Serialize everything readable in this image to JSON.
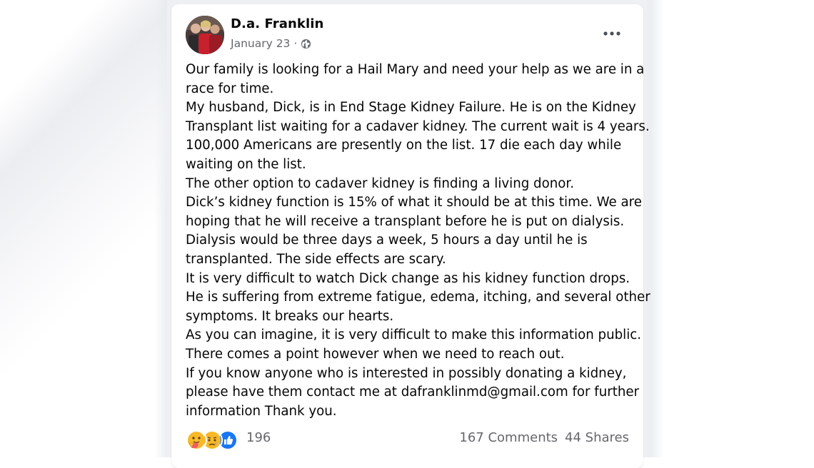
{
  "post": {
    "author": "D.a. Franklin",
    "date": "January 23",
    "separator": "·",
    "privacy_icon": "globe-icon",
    "more_icon": "more-options-icon",
    "body_lines": [
      "Our family is looking for a Hail Mary and need your help as we are in a",
      "race for time.",
      "My husband, Dick, is in End Stage Kidney Failure. He is on the Kidney",
      "Transplant list waiting for a cadaver kidney. The current wait is 4 years.",
      "100,000 Americans are presently on the list. 17 die each day while",
      "waiting on the list.",
      "The other option to cadaver kidney is finding a living donor.",
      "Dick’s kidney function is 15% of what it should be at this time. We are",
      "hoping that he will receive a transplant before he is put on dialysis.",
      "Dialysis would be three days a week, 5 hours a day until he is",
      "transplanted. The side effects are scary.",
      "It is very difficult to watch Dick change as his kidney function drops.",
      "He is suffering from extreme fatigue, edema, itching, and several other",
      "symptoms. It breaks our hearts.",
      "As you can imagine, it is very difficult to make this information public.",
      "There comes a point however when we need to reach out.",
      "If you know anyone who is interested in possibly donating a kidney,",
      "please have them contact me at dafranklinmd@gmail.com for further",
      "information Thank you."
    ]
  },
  "footer": {
    "reactions": [
      "care-reaction-icon",
      "sad-reaction-icon",
      "like-reaction-icon"
    ],
    "reaction_count": "196",
    "comments": "167 Comments",
    "shares": "44 Shares"
  },
  "colors": {
    "text": "#050505",
    "secondary": "#65676b",
    "like_blue": "#1877f2",
    "reaction_yellow": "#f7b928"
  }
}
